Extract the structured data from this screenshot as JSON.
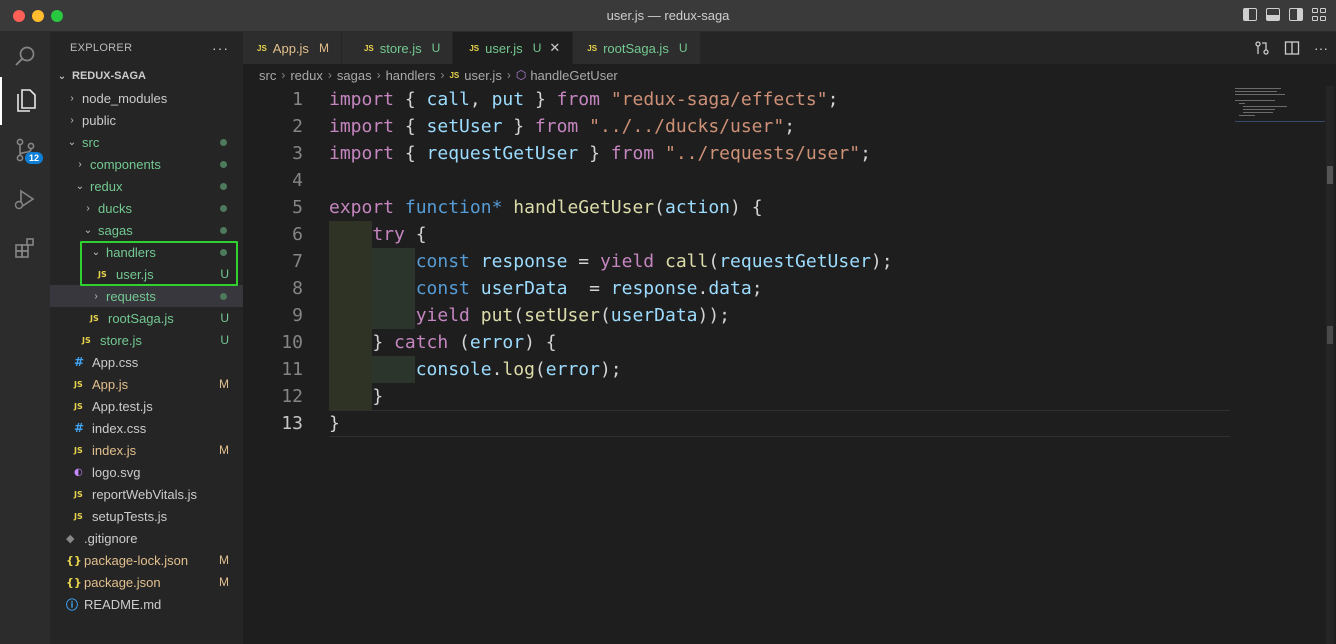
{
  "window": {
    "title": "user.js — redux-saga"
  },
  "activity_bar": {
    "source_control_badge": "12",
    "icons": [
      "search-icon",
      "files-icon",
      "source-control-icon",
      "run-debug-icon",
      "extensions-icon"
    ]
  },
  "sidebar": {
    "header": "EXPLORER",
    "more": "···",
    "root": "REDUX-SAGA",
    "items": [
      {
        "label": "node_modules"
      },
      {
        "label": "public"
      },
      {
        "label": "src"
      },
      {
        "label": "components"
      },
      {
        "label": "redux"
      },
      {
        "label": "ducks"
      },
      {
        "label": "sagas"
      },
      {
        "label": "handlers"
      },
      {
        "label": "user.js",
        "status": "U",
        "icon": "JS"
      },
      {
        "label": "requests"
      },
      {
        "label": "rootSaga.js",
        "status": "U",
        "icon": "JS"
      },
      {
        "label": "store.js",
        "status": "U",
        "icon": "JS"
      },
      {
        "label": "App.css",
        "icon": "#"
      },
      {
        "label": "App.js",
        "status": "M",
        "icon": "JS"
      },
      {
        "label": "App.test.js",
        "icon": "JS"
      },
      {
        "label": "index.css",
        "icon": "#"
      },
      {
        "label": "index.js",
        "status": "M",
        "icon": "JS"
      },
      {
        "label": "logo.svg"
      },
      {
        "label": "reportWebVitals.js",
        "icon": "JS"
      },
      {
        "label": "setupTests.js",
        "icon": "JS"
      },
      {
        "label": ".gitignore"
      },
      {
        "label": "package-lock.json",
        "status": "M",
        "icon": "{}"
      },
      {
        "label": "package.json",
        "status": "M",
        "icon": "{}"
      },
      {
        "label": "README.md"
      }
    ]
  },
  "tabs": [
    {
      "label": "App.js",
      "status": "M",
      "icon": "JS"
    },
    {
      "label": "store.js",
      "status": "U",
      "icon": "JS"
    },
    {
      "label": "user.js",
      "status": "U",
      "icon": "JS",
      "close": "✕"
    },
    {
      "label": "rootSaga.js",
      "status": "U",
      "icon": "JS"
    }
  ],
  "breadcrumb": [
    "src",
    "redux",
    "sagas",
    "handlers",
    "user.js",
    "handleGetUser"
  ],
  "editor": {
    "line_numbers": [
      "1",
      "2",
      "3",
      "4",
      "5",
      "6",
      "7",
      "8",
      "9",
      "10",
      "11",
      "12",
      "13"
    ],
    "lines": [
      "import { call, put } from \"redux-saga/effects\";",
      "import { setUser } from \"../../ducks/user\";",
      "import { requestGetUser } from \"../requests/user\";",
      "",
      "export function* handleGetUser(action) {",
      "    try {",
      "        const response = yield call(requestGetUser);",
      "        const userData  = response.data;",
      "        yield put(setUser(userData));",
      "    } catch (error) {",
      "        console.log(error);",
      "    }",
      "}"
    ]
  }
}
